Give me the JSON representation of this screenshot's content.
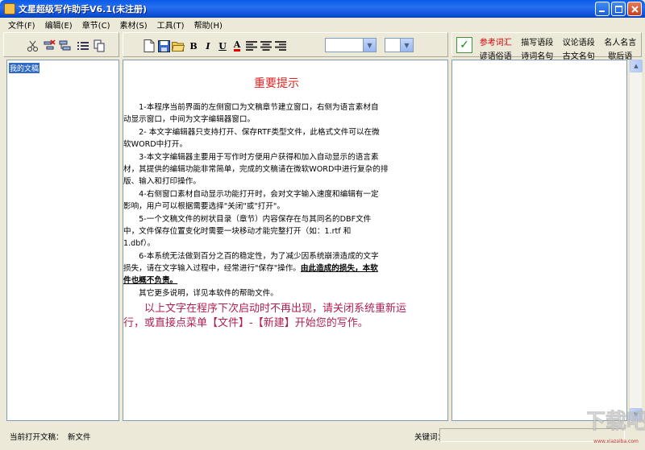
{
  "window": {
    "title": "文星超级写作助手V6.1(未注册)"
  },
  "menu": [
    {
      "label": "文件(F)"
    },
    {
      "label": "编辑(E)"
    },
    {
      "label": "章节(C)"
    },
    {
      "label": "素材(S)"
    },
    {
      "label": "工具(T)"
    },
    {
      "label": "帮助(H)"
    }
  ],
  "material_tabs": [
    {
      "label": "参考词汇",
      "active": true
    },
    {
      "label": "描写语段"
    },
    {
      "label": "议论语段"
    },
    {
      "label": "名人名言"
    },
    {
      "label": "谚语俗语"
    },
    {
      "label": "诗词名句"
    },
    {
      "label": "古文名句"
    },
    {
      "label": "歇后语"
    }
  ],
  "tree": {
    "root_label": "我的文稿"
  },
  "document": {
    "title": "重要提示",
    "lines": [
      "　　1-本程序当前界面的左侧窗口为文稿章节建立窗口，右侧为语言素材自",
      "动显示窗口，中间为文字编辑器窗口。",
      "　　2- 本文字编辑器只支持打开、保存RTF类型文件，此格式文件可以在微",
      "软WORD中打开。",
      "　　3-本文字编辑器主要用于写作时方便用户获得和加入自动显示的语言素",
      "材，其提供的编辑功能非常简单，完成的文稿请在微软WORD中进行复杂的排",
      "版、输入和打印操作。",
      "　　4-右侧窗口素材自动显示功能打开时，会对文字输入速度和编辑有一定",
      "影响，用户可以根据需要选择\"关闭\"或\"打开\"。",
      "　　5-一个文稿文件的树状目录（章节）内容保存在与其同名的DBF文件",
      "中，文件保存位置变化时需要一块移动才能完整打开（如：1.rtf 和",
      "1.dbf）。",
      "　　6-本系统无法做到百分之百的稳定性，为了减少因系统崩溃造成的文字",
      "损失，请在文字输入过程中，经常进行\"保存\"操作。",
      "件也概不负责。",
      "　　其它更多说明，详见本软件的帮助文件。"
    ],
    "bold_tail_a": "由此造成的损失，本软",
    "tail_lines": [
      "　　以上文字在程序下次启动时不再出现，请关闭系统重新运",
      "行，或直接点菜单【文件】-【新建】开始您的写作。"
    ]
  },
  "status": {
    "current_file_label": "当前打开文稿：",
    "current_file_value": "新文件",
    "keyword_label": "关键词："
  },
  "watermark": {
    "text": "下载吧",
    "site": "www.xiazaiba.com"
  }
}
